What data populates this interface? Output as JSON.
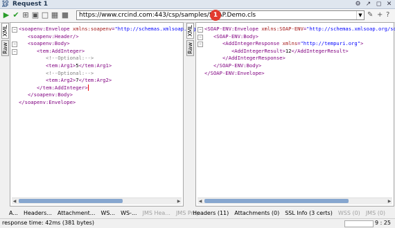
{
  "window": {
    "title": "Request 1",
    "icon": "soap-request-icon"
  },
  "toolbar": {
    "url": "https://www.crcind.com:443/csp/samples/SOAP.Demo.cls",
    "badge": "1",
    "icons": [
      "run-icon",
      "validate-icon",
      "add-header-icon",
      "split-icon",
      "tab-icon",
      "layout-icon",
      "stop-icon"
    ]
  },
  "left_tabs": [
    "XML",
    "Raw"
  ],
  "right_tabs": [
    "XML",
    "Raw"
  ],
  "request_lines": [
    {
      "indent": "",
      "parts": [
        [
          "tag",
          "<soapenv:Envelope "
        ],
        [
          "attr",
          "xmlns:soapenv"
        ],
        [
          "tag",
          "="
        ],
        [
          "val",
          "\"http://schemas.xmlsoap.org/"
        ]
      ]
    },
    {
      "indent": "   ",
      "parts": [
        [
          "tag",
          "<soapenv:Header/>"
        ]
      ]
    },
    {
      "indent": "   ",
      "parts": [
        [
          "tag",
          "<soapenv:Body>"
        ]
      ]
    },
    {
      "indent": "      ",
      "parts": [
        [
          "tag",
          "<tem:AddInteger>"
        ]
      ]
    },
    {
      "indent": "         ",
      "parts": [
        [
          "cmt",
          "<!--Optional:-->"
        ]
      ]
    },
    {
      "indent": "         ",
      "parts": [
        [
          "tag",
          "<tem:Arg1>"
        ],
        [
          "txt",
          "5"
        ],
        [
          "tag",
          "</tem:Arg1>"
        ]
      ]
    },
    {
      "indent": "         ",
      "parts": [
        [
          "cmt",
          "<!--Optional:-->"
        ]
      ]
    },
    {
      "indent": "         ",
      "parts": [
        [
          "tag",
          "<tem:Arg2>"
        ],
        [
          "txt",
          "7"
        ],
        [
          "tag",
          "</tem:Arg2>"
        ]
      ]
    },
    {
      "indent": "      ",
      "parts": [
        [
          "tag",
          "</tem:AddInteger>"
        ]
      ],
      "caret": true
    },
    {
      "indent": "   ",
      "parts": [
        [
          "tag",
          "</soapenv:Body>"
        ]
      ]
    },
    {
      "indent": "",
      "parts": [
        [
          "tag",
          "</soapenv:Envelope>"
        ]
      ]
    }
  ],
  "response_lines": [
    {
      "indent": "",
      "parts": [
        [
          "tag",
          "<SOAP-ENV:Envelope "
        ],
        [
          "attr",
          "xmlns:SOAP-ENV"
        ],
        [
          "tag",
          "="
        ],
        [
          "val",
          "\"http://schemas.xmlsoap.org/soap"
        ]
      ]
    },
    {
      "indent": "   ",
      "parts": [
        [
          "tag",
          "<SOAP-ENV:Body>"
        ]
      ]
    },
    {
      "indent": "      ",
      "parts": [
        [
          "tag",
          "<AddIntegerResponse "
        ],
        [
          "attr",
          "xmlns"
        ],
        [
          "tag",
          "="
        ],
        [
          "val",
          "\"http://tempuri.org\""
        ],
        [
          "tag",
          ">"
        ]
      ]
    },
    {
      "indent": "         ",
      "parts": [
        [
          "tag",
          "<AddIntegerResult>"
        ],
        [
          "txt",
          "12"
        ],
        [
          "tag",
          "</AddIntegerResult>"
        ]
      ]
    },
    {
      "indent": "      ",
      "parts": [
        [
          "tag",
          "</AddIntegerResponse>"
        ]
      ]
    },
    {
      "indent": "   ",
      "parts": [
        [
          "tag",
          "</SOAP-ENV:Body>"
        ]
      ]
    },
    {
      "indent": "",
      "parts": [
        [
          "tag",
          "</SOAP-ENV:Envelope>"
        ]
      ]
    }
  ],
  "request_bottom_tabs": [
    {
      "label": "A...",
      "disabled": false
    },
    {
      "label": "Headers...",
      "disabled": false
    },
    {
      "label": "Attachment...",
      "disabled": false
    },
    {
      "label": "WS...",
      "disabled": false
    },
    {
      "label": "WS-...",
      "disabled": false
    },
    {
      "label": "JMS Hea...",
      "disabled": true
    },
    {
      "label": "JMS Prop...",
      "disabled": true
    }
  ],
  "response_bottom_tabs": [
    {
      "label": "Headers (11)",
      "disabled": false
    },
    {
      "label": "Attachments (0)",
      "disabled": false
    },
    {
      "label": "SSL Info (3 certs)",
      "disabled": false
    },
    {
      "label": "WSS (0)",
      "disabled": true
    },
    {
      "label": "JMS (0)",
      "disabled": true
    }
  ],
  "status": {
    "response": "response time: 42ms (381 bytes)",
    "position": "9 : 25"
  }
}
